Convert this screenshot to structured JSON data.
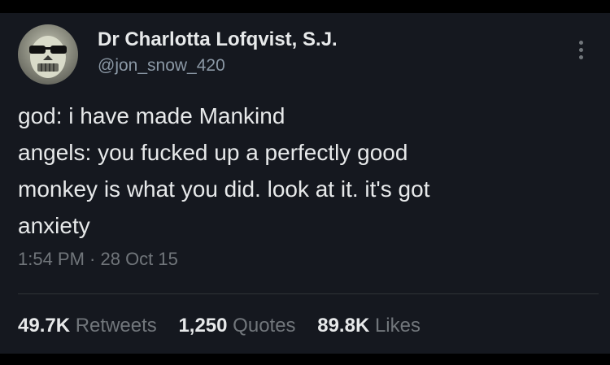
{
  "tweet": {
    "author_name": "Dr Charlotta Lofqvist, S.J.",
    "handle": "@jon_snow_420",
    "avatar_icon": "sunglasses-skull-avatar",
    "more_icon": "more-options-icon",
    "text_lines": [
      "god: i have made Mankind",
      "angels: you fucked up a perfectly good",
      "monkey is what you did. look at it. it's got",
      "anxiety"
    ],
    "timestamp": "1:54 PM · 28 Oct 15",
    "stats": [
      {
        "count": "49.7K",
        "label": "Retweets"
      },
      {
        "count": "1,250",
        "label": "Quotes"
      },
      {
        "count": "89.8K",
        "label": "Likes"
      }
    ]
  },
  "colors": {
    "background": "#15181f",
    "primary_text": "#e7e9ea",
    "secondary_text": "#71767b",
    "divider": "#2f3336"
  }
}
